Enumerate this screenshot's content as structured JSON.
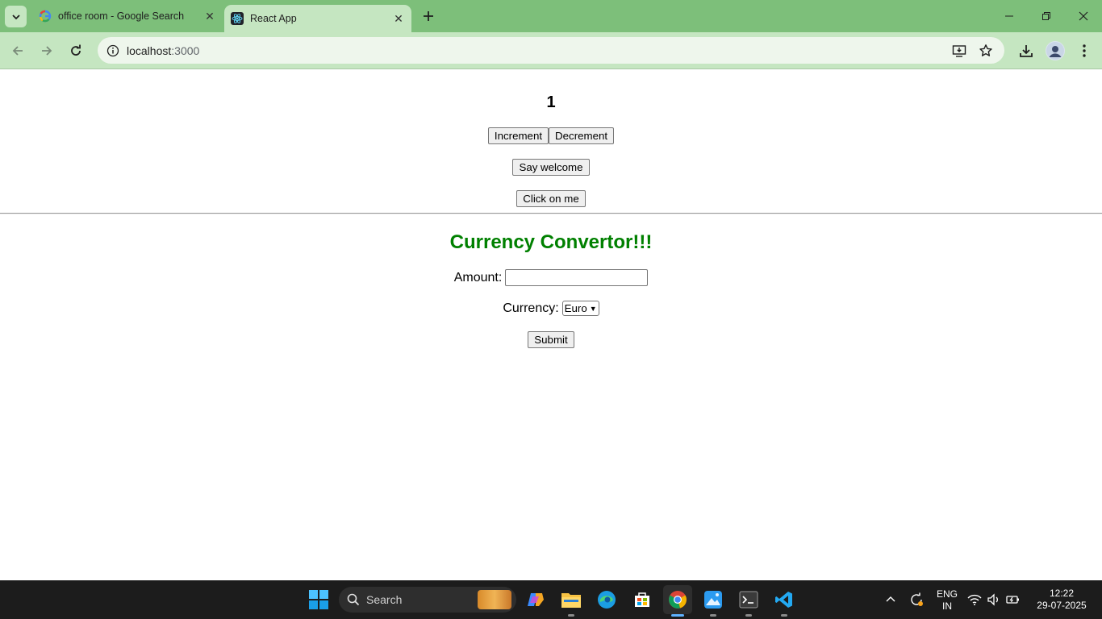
{
  "browser": {
    "tabs": [
      {
        "title": "office room - Google Search",
        "favicon": "google-g-icon",
        "active": false
      },
      {
        "title": "React App",
        "favicon": "react-icon",
        "active": true
      }
    ],
    "url_host": "localhost",
    "url_port": ":3000"
  },
  "app": {
    "counter_value": "1",
    "increment_label": "Increment",
    "decrement_label": "Decrement",
    "welcome_label": "Say welcome",
    "click_label": "Click on me",
    "converter": {
      "title": "Currency Convertor!!!",
      "title_color": "#008000",
      "amount_label": "Amount:",
      "amount_value": "",
      "currency_label": "Currency:",
      "currency_selected": "Euro",
      "submit_label": "Submit"
    }
  },
  "taskbar": {
    "search_placeholder": "Search",
    "lang_line1": "ENG",
    "lang_line2": "IN",
    "time": "12:22",
    "date": "29-07-2025"
  },
  "colors": {
    "tabstrip": "#7dbf7a",
    "toolbar": "#c5e6c1",
    "taskbar": "#1c1c1c"
  }
}
